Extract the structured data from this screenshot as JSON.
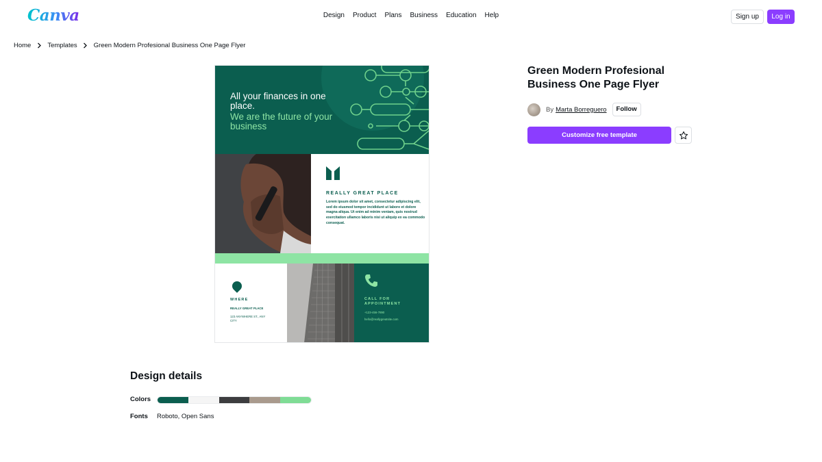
{
  "header": {
    "logo": "Canva",
    "nav": [
      "Design",
      "Product",
      "Plans",
      "Business",
      "Education",
      "Help"
    ],
    "signup_label": "Sign up",
    "login_label": "Log in"
  },
  "breadcrumb": [
    "Home",
    "Templates",
    "Green Modern Profesional Business One Page Flyer"
  ],
  "flyer": {
    "headline_white": "All your finances in one place.",
    "headline_green": "We are the future of your business",
    "place_heading": "REALLY GREAT PLACE",
    "lorem": "Lorem ipsum dolor sit amet, consectetur adipiscing elit, sed do eiusmod tempor incididunt ut labore et dolore magna aliqua. Ut enim ad minim veniam, quis nostrud exercitation ullamco laboris nisi ut aliquip ex ea commodo consequat.",
    "where_heading": "WHERE",
    "where_name": "REALLY GREAT PLACE",
    "where_address": "123 ANYWHERE ST., ANY CITY",
    "call_heading": "CALL FOR APPOINTMENT",
    "phone": "+123-456-7890",
    "email": "hello@reallygreatsite.com"
  },
  "template": {
    "title": "Green Modern Profesional Business One Page Flyer",
    "by_label": "By",
    "author": "Marta Borreguero",
    "follow_label": "Follow",
    "customize_label": "Customize free template",
    "favorite_icon": "star-icon"
  },
  "design_details": {
    "title": "Design details",
    "colors_label": "Colors",
    "colors": [
      "#0b5e4f",
      "#f5f5f5",
      "#3d3d3f",
      "#a99a8d",
      "#7fdc95"
    ],
    "fonts_label": "Fonts",
    "fonts_value": "Roboto, Open Sans"
  },
  "colors": {
    "accent": "#8b3dff",
    "flyer_green": "#0b5e4f",
    "flyer_light_green": "#8ee4a4"
  }
}
